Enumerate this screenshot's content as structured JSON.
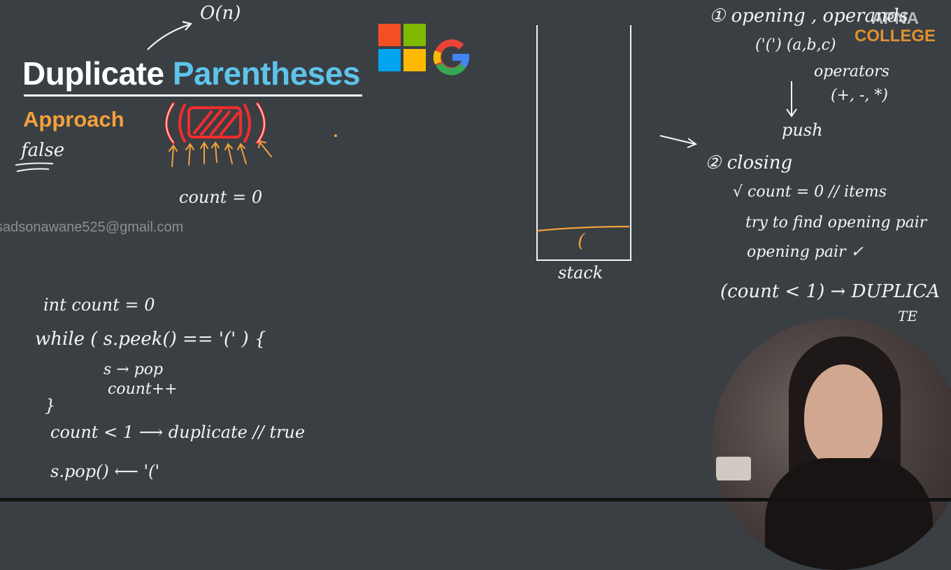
{
  "slide": {
    "title_part1": "Duplicate",
    "title_part2": "Parentheses",
    "subtitle": "Approach",
    "watermark": "sadsonawane525@gmail.com",
    "brand": {
      "line1": "APNA",
      "line2": "COLLEGE"
    }
  },
  "annotations": {
    "complexity": "O(n)",
    "false_note": "false",
    "count_init": "count = 0",
    "stack_label": "stack",
    "stack_item": "(",
    "step1_a": "① opening , operands",
    "step1_b": "('(')    (a,b,c)",
    "step1_c": "operators",
    "step1_d": "(+, -, *)",
    "step1_push": "push",
    "step2_a": "② closing",
    "step2_b": "√ count = 0 // items",
    "step2_c": "try to find opening pair",
    "step2_d": "opening pair ✓",
    "step2_e": "(count < 1) → DUPLICA",
    "step2_f": "TE"
  },
  "code": {
    "line1": "int count = 0",
    "line2": "while ( s.peek() == '(' ) {",
    "line3": "s → pop",
    "line4": "count++",
    "line5": "}",
    "line6": "count < 1  ⟶  duplicate // true",
    "line7": "s.pop()  ⟵  '('"
  },
  "colors": {
    "background": "#3a3f44",
    "title_accent": "#5ec4ea",
    "subtitle": "#f3a03b",
    "highlight_red": "#ff2b2b",
    "arrow_orange": "#f3a03b"
  },
  "icons": [
    "microsoft-logo",
    "google-logo",
    "apna-college-logo"
  ]
}
